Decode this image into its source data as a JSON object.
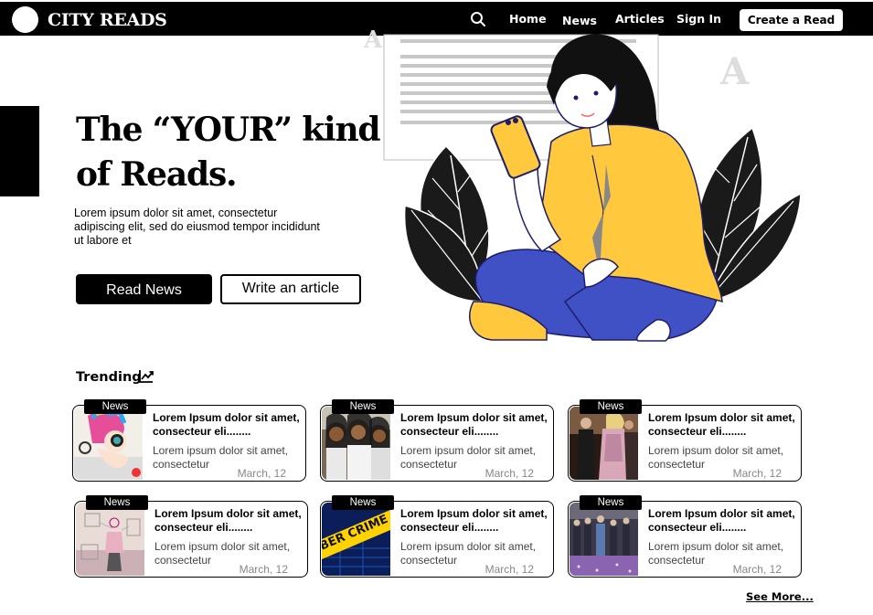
{
  "nav": {
    "brand": "CITY READS",
    "links": [
      "Home",
      "News",
      "Articles",
      "Sign In"
    ],
    "create_button": "Create a  Read"
  },
  "hero": {
    "title_line1": "The “YOUR” kind",
    "title_line2": "of Reads.",
    "text": "Lorem ipsum dolor sit amet, consectetur adipiscing elit, sed do eiusmod tempor incididunt ut labore et",
    "read_button": "Read News",
    "write_button": "Write an article"
  },
  "illustration": {
    "letter_left": "A",
    "letter_right": "A"
  },
  "trending": {
    "heading": "Trending",
    "cards": [
      {
        "badge": "News",
        "title": "Lorem Ipsum dolor sit amet, consecteur eli........",
        "text": "Lorem ipsum dolor sit amet, consectetur",
        "date": "March, 12"
      },
      {
        "badge": "News",
        "title": "Lorem Ipsum dolor sit amet, consecteur eli........",
        "text": "Lorem ipsum dolor sit amet, consectetur",
        "date": "March, 12"
      },
      {
        "badge": "News",
        "title": "Lorem Ipsum dolor sit amet, consecteur eli........",
        "text": "Lorem ipsum dolor sit amet, consectetur",
        "date": "March, 12"
      },
      {
        "badge": "News",
        "title": "Lorem Ipsum dolor sit amet, consecteur eli........",
        "text": "Lorem ipsum dolor sit amet, consectetur",
        "date": "March, 12"
      },
      {
        "badge": "News",
        "title": "Lorem Ipsum dolor sit amet, consecteur eli........",
        "text": "Lorem ipsum dolor sit amet, consectetur",
        "date": "March, 12"
      },
      {
        "badge": "News",
        "title": "Lorem Ipsum dolor sit amet, consecteur eli........",
        "text": "Lorem ipsum dolor sit amet, consectetur",
        "date": "March, 12"
      }
    ],
    "crime_tape_text": "BER CRIME CY",
    "see_more": "See More..."
  },
  "icons": {
    "search": "search-icon",
    "trend": "trending-chart-icon"
  },
  "colors": {
    "nav_bg": "#000000",
    "accent_yellow": "#FFC83D",
    "accent_blue": "#3F51C4"
  }
}
